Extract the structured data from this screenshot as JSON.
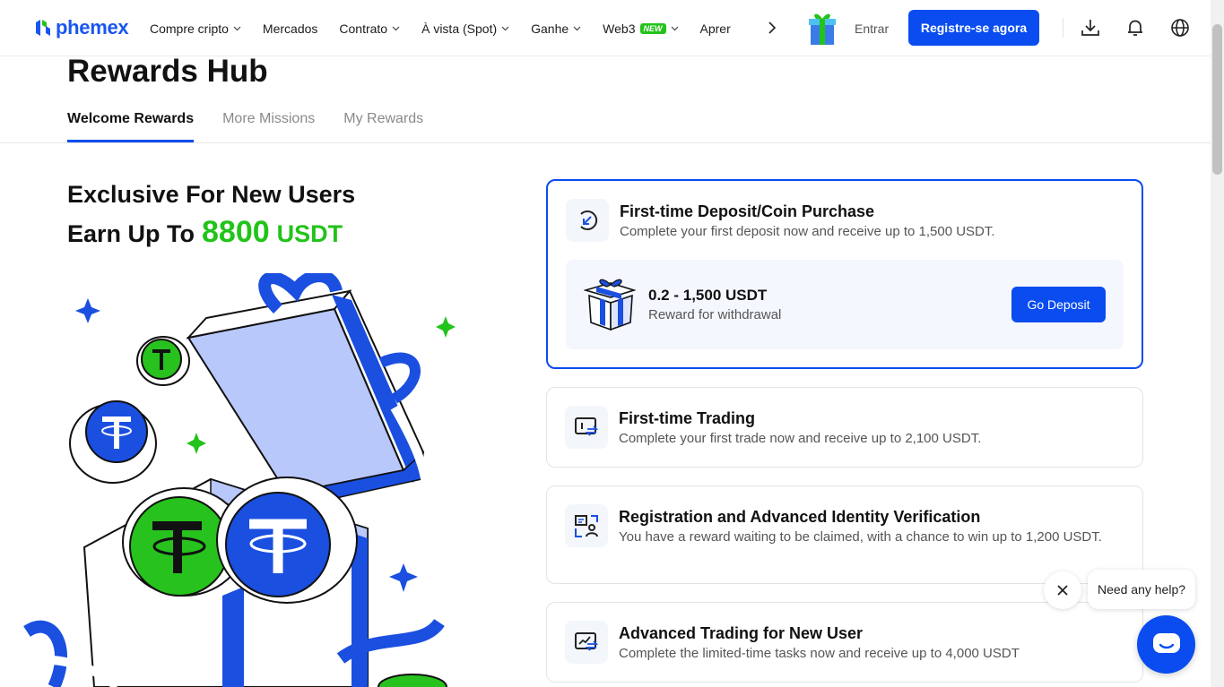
{
  "brand": {
    "name": "phemex",
    "primary_color": "#0a4cf0",
    "accent_green": "#22c31a"
  },
  "nav": {
    "items": [
      {
        "label": "Compre cripto",
        "has_dropdown": true
      },
      {
        "label": "Mercados",
        "has_dropdown": false
      },
      {
        "label": "Contrato",
        "has_dropdown": true
      },
      {
        "label": "À vista (Spot)",
        "has_dropdown": true
      },
      {
        "label": "Ganhe",
        "has_dropdown": true
      },
      {
        "label": "Web3",
        "has_dropdown": true,
        "badge": "NEW"
      },
      {
        "label": "Aprer",
        "has_dropdown": false
      }
    ],
    "login_label": "Entrar",
    "register_label": "Registre-se agora",
    "icons": [
      "download-icon",
      "bell-icon",
      "globe-icon"
    ]
  },
  "page": {
    "title": "Rewards Hub",
    "tabs": [
      {
        "label": "Welcome Rewards",
        "active": true
      },
      {
        "label": "More Missions",
        "active": false
      },
      {
        "label": "My Rewards",
        "active": false
      }
    ]
  },
  "hero": {
    "line1": "Exclusive For New Users",
    "line2_prefix": "Earn Up To",
    "amount": "8800",
    "unit": "USDT"
  },
  "tasks": [
    {
      "title": "First-time Deposit/Coin Purchase",
      "desc": "Complete your first deposit now and receive up to 1,500 USDT.",
      "icon": "deposit-arrow-icon",
      "reward_amount": "0.2 - 1,500 USDT",
      "reward_label": "Reward for withdrawal",
      "button_label": "Go Deposit"
    },
    {
      "title": "First-time Trading",
      "desc": "Complete your first trade now and receive up to 2,100 USDT.",
      "icon": "trade-icon"
    },
    {
      "title": "Registration and Advanced Identity Verification",
      "desc": "You have a reward waiting to be claimed, with a chance to win up to 1,200 USDT.",
      "icon": "identity-verification-icon"
    },
    {
      "title": "Advanced Trading for New User",
      "desc": "Complete the limited-time tasks now and receive up to 4,000 USDT",
      "icon": "advanced-trading-icon"
    }
  ],
  "help": {
    "bubble_text": "Need any help?"
  }
}
